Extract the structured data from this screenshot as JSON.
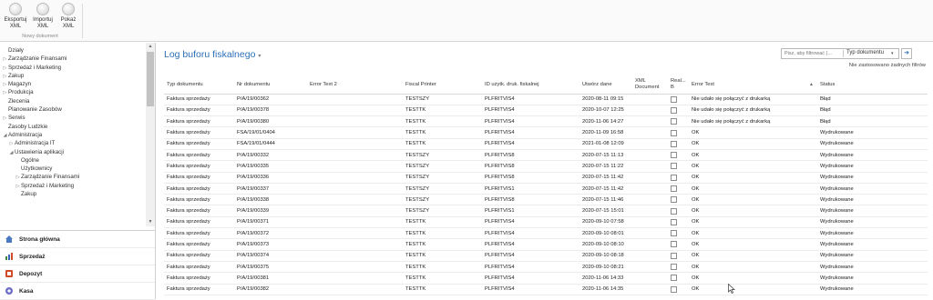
{
  "ribbon": {
    "buttons": [
      {
        "label_line1": "Eksportuj",
        "label_line2": "XML"
      },
      {
        "label_line1": "Importuj",
        "label_line2": "XML"
      },
      {
        "label_line1": "Pokaż",
        "label_line2": "XML"
      }
    ],
    "group_label": "Nowy dokument"
  },
  "sidebar": {
    "tree": [
      {
        "label": "Działy",
        "arrow": "",
        "indent": 0
      },
      {
        "label": "Zarządzanie Finansami",
        "arrow": "▷",
        "indent": 0
      },
      {
        "label": "Sprzedaż i Marketing",
        "arrow": "▷",
        "indent": 0
      },
      {
        "label": "Zakup",
        "arrow": "▷",
        "indent": 0
      },
      {
        "label": "Magazyn",
        "arrow": "▷",
        "indent": 0
      },
      {
        "label": "Produkcja",
        "arrow": "▷",
        "indent": 0
      },
      {
        "label": "Zlecenia",
        "arrow": "",
        "indent": 0
      },
      {
        "label": "Planowanie Zasobów",
        "arrow": "",
        "indent": 0
      },
      {
        "label": "Serwis",
        "arrow": "▷",
        "indent": 0
      },
      {
        "label": "Zasoby Ludzkie",
        "arrow": "",
        "indent": 0
      },
      {
        "label": "Administracja",
        "arrow": "◢",
        "indent": 0
      },
      {
        "label": "Administracja IT",
        "arrow": "▷",
        "indent": 1
      },
      {
        "label": "Ustawienia aplikacji",
        "arrow": "◢",
        "indent": 1
      },
      {
        "label": "Ogólne",
        "arrow": "",
        "indent": 2
      },
      {
        "label": "Użytkownicy",
        "arrow": "",
        "indent": 2
      },
      {
        "label": "Zarządzanie Finansami",
        "arrow": "▷",
        "indent": 2
      },
      {
        "label": "Sprzedaż i Marketing",
        "arrow": "▷",
        "indent": 2
      },
      {
        "label": "Zakup",
        "arrow": "",
        "indent": 2
      }
    ],
    "nav": [
      {
        "label": "Strona główna",
        "color": "#4a78c2"
      },
      {
        "label": "Sprzedaż",
        "color": "#3b8a3b"
      },
      {
        "label": "Depozyt",
        "color": "#d24a2a"
      },
      {
        "label": "Kasa",
        "color": "#6e6ec8"
      }
    ]
  },
  "main": {
    "title": "Log buforu fiskalnego",
    "title_caret": "▾",
    "search_placeholder": "Pisz, aby filtrować (...",
    "search_type": "Typ dokumentu",
    "search_caret": "▾",
    "search_go": "➜",
    "no_filters": "Nie zastosowano żadnych filtrów",
    "columns": [
      "Typ dokumentu",
      "Nr dokumentu",
      "Error Text 2",
      "Fiscal Printer",
      "ID użytk. druk. fiskalnej",
      "Utwórz dane",
      "XML Document",
      "Real... B",
      "Error Text",
      "Status"
    ],
    "rows": [
      [
        "Faktura sprzedaży",
        "P/A/19/00362",
        "",
        "TESTSZY",
        "PLFRITVIS4",
        "2020-08-11 09:15",
        "",
        "",
        "Nie udało się połączyć z drukarką",
        "Błąd"
      ],
      [
        "Faktura sprzedaży",
        "P/A/19/00378",
        "",
        "TESTTK",
        "PLFRITVIS4",
        "2020-10-07 12:25",
        "",
        "",
        "Nie udało się połączyć z drukarką",
        "Błąd"
      ],
      [
        "Faktura sprzedaży",
        "P/A/19/00380",
        "",
        "TESTTK",
        "PLFRITVIS4",
        "2020-11-06 14:27",
        "",
        "",
        "Nie udało się połączyć z drukarką",
        "Błąd"
      ],
      [
        "Faktura sprzedaży",
        "FSA/19/01/0404",
        "",
        "TESTTK",
        "PLFRITVIS4",
        "2020-11-09 16:58",
        "",
        "",
        "OK",
        "Wydrukowane"
      ],
      [
        "Faktura sprzedaży",
        "FSA/19/01/0444",
        "",
        "TESTTK",
        "PLFRITVIS4",
        "2021-01-08 12:09",
        "",
        "",
        "OK",
        "Wydrukowane"
      ],
      [
        "Faktura sprzedaży",
        "P/A/19/00332",
        "",
        "TESTSZY",
        "PLFRITVIS8",
        "2020-07-15 11:13",
        "",
        "",
        "OK",
        "Wydrukowane"
      ],
      [
        "Faktura sprzedaży",
        "P/A/19/00335",
        "",
        "TESTSZY",
        "PLFRITVIS8",
        "2020-07-15 11:22",
        "",
        "",
        "OK",
        "Wydrukowane"
      ],
      [
        "Faktura sprzedaży",
        "P/A/19/00336",
        "",
        "TESTSZY",
        "PLFRITVIS8",
        "2020-07-15 11:42",
        "",
        "",
        "OK",
        "Wydrukowane"
      ],
      [
        "Faktura sprzedaży",
        "P/A/19/00337",
        "",
        "TESTSZY",
        "PLFRITVIS1",
        "2020-07-15 11:42",
        "",
        "",
        "OK",
        "Wydrukowane"
      ],
      [
        "Faktura sprzedaży",
        "P/A/19/00338",
        "",
        "TESTSZY",
        "PLFRITVIS8",
        "2020-07-15 11:46",
        "",
        "",
        "OK",
        "Wydrukowane"
      ],
      [
        "Faktura sprzedaży",
        "P/A/19/00339",
        "",
        "TESTSZY",
        "PLFRITVIS1",
        "2020-07-15 15:01",
        "",
        "",
        "OK",
        "Wydrukowane"
      ],
      [
        "Faktura sprzedaży",
        "P/A/19/00371",
        "",
        "TESTTK",
        "PLFRITVIS4",
        "2020-09-10 07:58",
        "",
        "",
        "OK",
        "Wydrukowane"
      ],
      [
        "Faktura sprzedaży",
        "P/A/19/00372",
        "",
        "TESTTK",
        "PLFRITVIS4",
        "2020-09-10 08:01",
        "",
        "",
        "OK",
        "Wydrukowane"
      ],
      [
        "Faktura sprzedaży",
        "P/A/19/00373",
        "",
        "TESTTK",
        "PLFRITVIS4",
        "2020-09-10 08:10",
        "",
        "",
        "OK",
        "Wydrukowane"
      ],
      [
        "Faktura sprzedaży",
        "P/A/19/00374",
        "",
        "TESTTK",
        "PLFRITVIS4",
        "2020-09-10 08:18",
        "",
        "",
        "OK",
        "Wydrukowane"
      ],
      [
        "Faktura sprzedaży",
        "P/A/19/00375",
        "",
        "TESTTK",
        "PLFRITVIS4",
        "2020-09-10 08:21",
        "",
        "",
        "OK",
        "Wydrukowane"
      ],
      [
        "Faktura sprzedaży",
        "P/A/19/00381",
        "",
        "TESTTK",
        "PLFRITVIS4",
        "2020-11-06 14:33",
        "",
        "",
        "OK",
        "Wydrukowane"
      ],
      [
        "Faktura sprzedaży",
        "P/A/19/00382",
        "",
        "TESTTK",
        "PLFRITVIS4",
        "2020-11-06 14:35",
        "",
        "",
        "OK",
        "Wydrukowane"
      ]
    ]
  }
}
